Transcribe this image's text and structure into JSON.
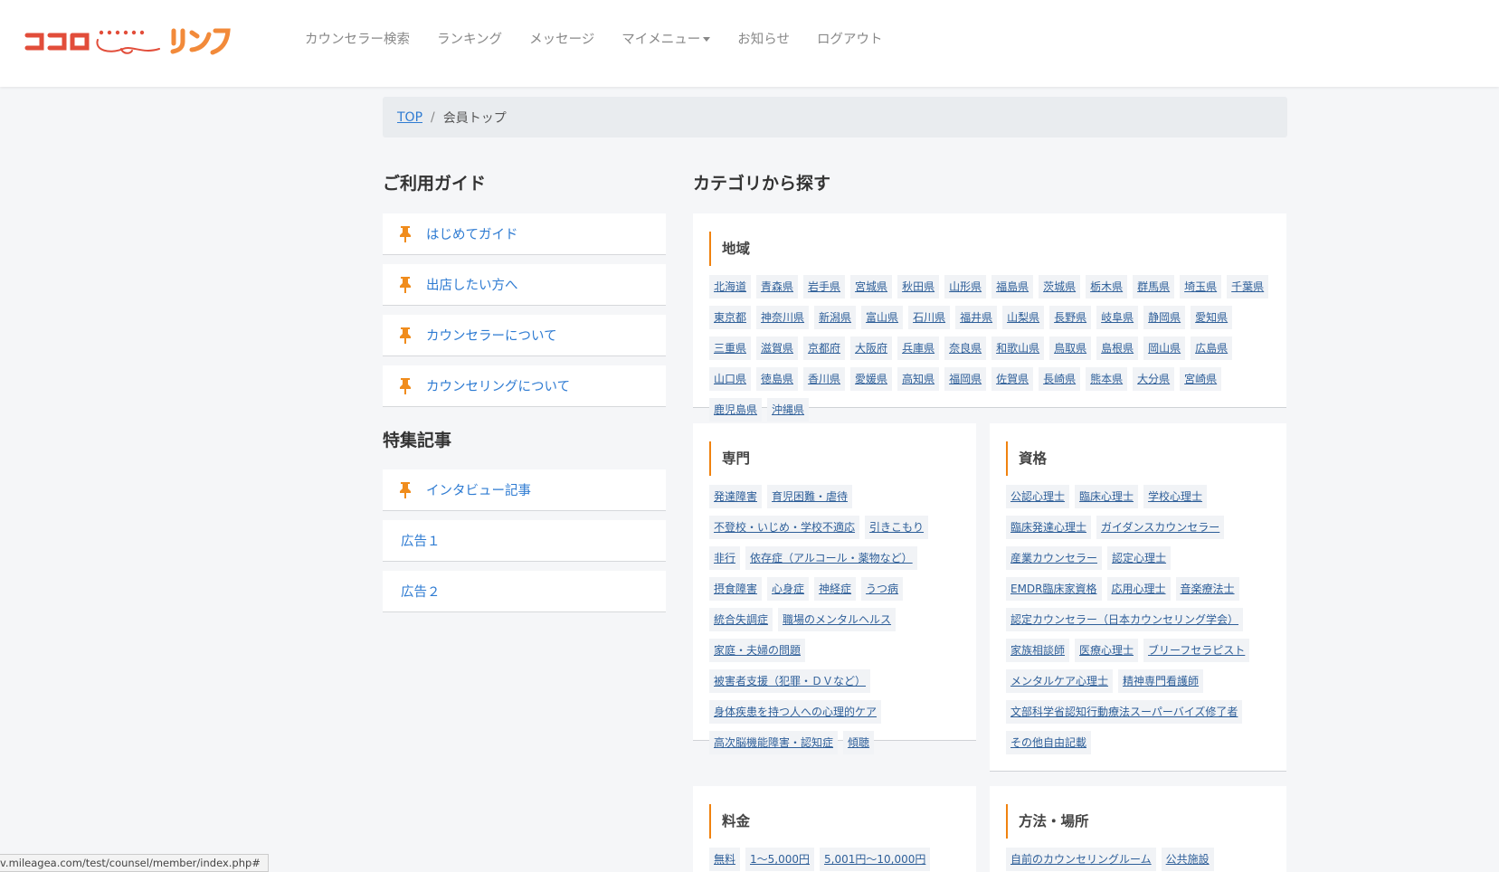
{
  "brand": {
    "logo_text": "ココロ kokoro リンク"
  },
  "nav": {
    "items": [
      "カウンセラー検索",
      "ランキング",
      "メッセージ",
      "マイメニュー",
      "お知らせ",
      "ログアウト"
    ]
  },
  "breadcrumb": {
    "home": "TOP",
    "separator": "/",
    "current": "会員トップ"
  },
  "guide": {
    "title": "ご利用ガイド",
    "items": [
      "はじめてガイド",
      "出店したい方へ",
      "カウンセラーについて",
      "カウンセリングについて"
    ]
  },
  "features": {
    "title": "特集記事",
    "items": [
      "インタビュー記事",
      "広告１",
      "広告２"
    ]
  },
  "categories": {
    "title": "カテゴリから探す",
    "region": {
      "title": "地域",
      "tags": [
        "北海道",
        "青森県",
        "岩手県",
        "宮城県",
        "秋田県",
        "山形県",
        "福島県",
        "茨城県",
        "栃木県",
        "群馬県",
        "埼玉県",
        "千葉県",
        "東京都",
        "神奈川県",
        "新潟県",
        "富山県",
        "石川県",
        "福井県",
        "山梨県",
        "長野県",
        "岐阜県",
        "静岡県",
        "愛知県",
        "三重県",
        "滋賀県",
        "京都府",
        "大阪府",
        "兵庫県",
        "奈良県",
        "和歌山県",
        "鳥取県",
        "島根県",
        "岡山県",
        "広島県",
        "山口県",
        "徳島県",
        "香川県",
        "愛媛県",
        "高知県",
        "福岡県",
        "佐賀県",
        "長崎県",
        "熊本県",
        "大分県",
        "宮崎県",
        "鹿児島県",
        "沖縄県"
      ]
    },
    "specialty": {
      "title": "専門",
      "tags": [
        "発達障害",
        "育児困難・虐待",
        "不登校・いじめ・学校不適応",
        "引きこもり",
        "非行",
        "依存症（アルコール・薬物など）",
        "摂食障害",
        "心身症",
        "神経症",
        "うつ病",
        "統合失調症",
        "職場のメンタルヘルス",
        "家庭・夫婦の問題",
        "被害者支援（犯罪・ＤＶなど）",
        "身体疾患を持つ人への心理的ケア",
        "高次脳機能障害・認知症",
        "傾聴"
      ]
    },
    "qualification": {
      "title": "資格",
      "tags": [
        "公認心理士",
        "臨床心理士",
        "学校心理士",
        "臨床発達心理士",
        "ガイダンスカウンセラー",
        "産業カウンセラー",
        "認定心理士",
        "EMDR臨床家資格",
        "応用心理士",
        "音楽療法士",
        "認定カウンセラー（日本カウンセリング学会）",
        "家族相談師",
        "医療心理士",
        "ブリーフセラピスト",
        "メンタルケア心理士",
        "精神専門看護師",
        "文部科学省認知行動療法スーパーバイズ修了者",
        "その他自由記載"
      ]
    },
    "fee": {
      "title": "料金",
      "tags": [
        "無料",
        "1〜5,000円",
        "5,001円〜10,000円"
      ]
    },
    "method": {
      "title": "方法・場所",
      "tags": [
        "自前のカウンセリングルーム",
        "公共施設"
      ]
    }
  },
  "status_bar": {
    "url": "v.mileagea.com/test/counsel/member/index.php#"
  },
  "colors": {
    "accent": "#f0820f",
    "link": "#2e7bd2",
    "tag_text": "#2e5f99"
  }
}
